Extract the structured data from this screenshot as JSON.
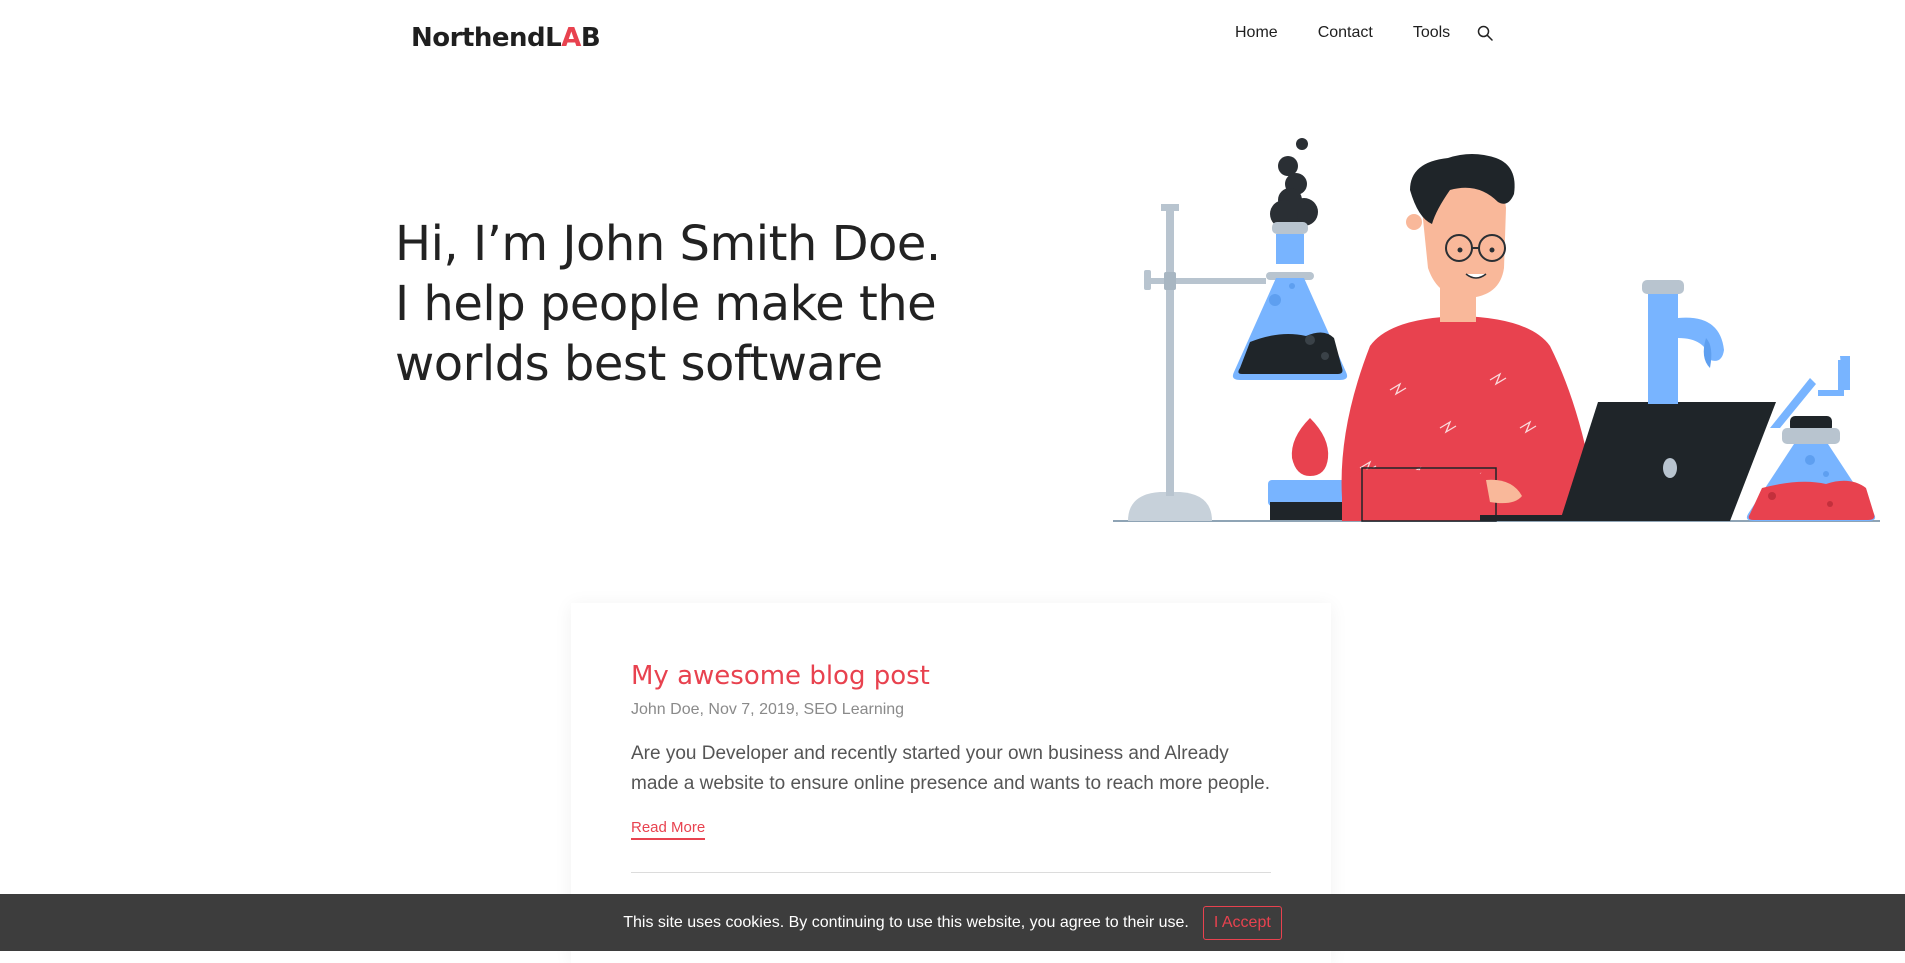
{
  "header": {
    "logo_text_a": "Northend",
    "logo_text_b": "L",
    "logo_text_c": "A",
    "logo_text_d": "B",
    "nav": [
      {
        "label": "Home"
      },
      {
        "label": "Contact"
      },
      {
        "label": "Tools"
      }
    ],
    "search_icon": "search-icon"
  },
  "hero": {
    "line1": "Hi, I’m John Smith Doe.",
    "line2": "I help people make the",
    "line3": "worlds best software",
    "illustration": "scientist-at-laptop-with-lab-flasks"
  },
  "post": {
    "title": "My awesome blog post",
    "meta": "John Doe, Nov 7, 2019, SEO Learning",
    "excerpt": "Are you Developer and recently started your own business and Already made a website to ensure online presence and wants to reach more people.",
    "read_more": "Read More"
  },
  "cookie": {
    "text": "This site uses cookies. By continuing to use this website, you agree to their use.",
    "accept": "I Accept"
  },
  "colors": {
    "accent": "#e8424f",
    "text": "#222222",
    "cookie_bg": "#3d3d3d"
  }
}
